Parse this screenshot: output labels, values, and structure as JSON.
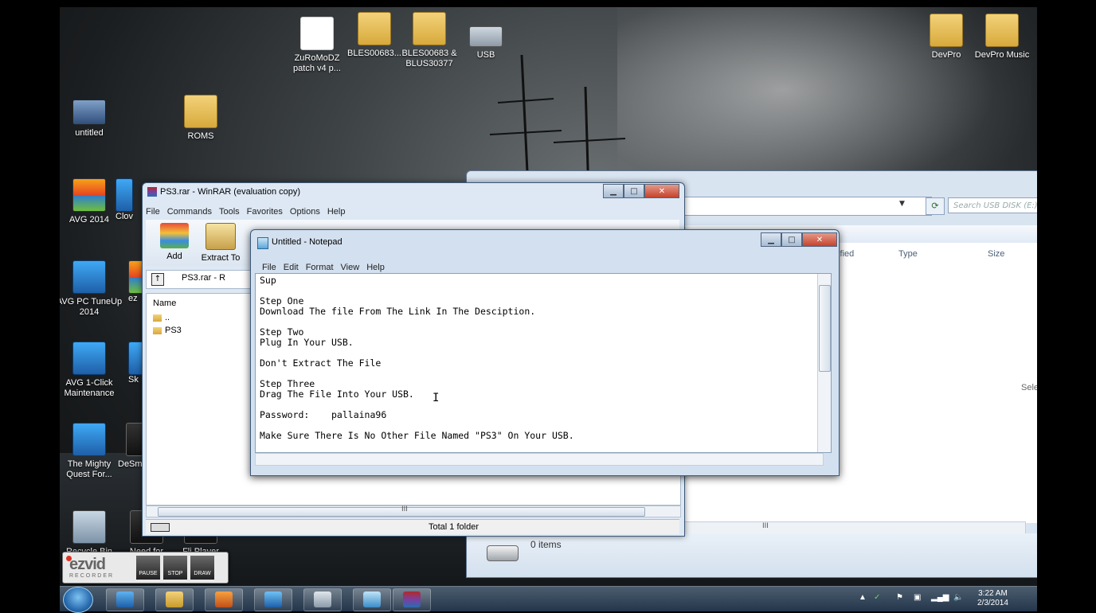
{
  "desktop": {
    "icons": [
      {
        "label": "ZuRoMoDZ patch v4 p...",
        "icon": "file-icon"
      },
      {
        "label": "BLES00683...",
        "icon": "folder-icon"
      },
      {
        "label": "BLES00683 & BLUS30377",
        "icon": "folder-icon"
      },
      {
        "label": "USB",
        "icon": "usb-drive-icon"
      },
      {
        "label": "DevPro",
        "icon": "folder-icon"
      },
      {
        "label": "DevPro Music",
        "icon": "folder-icon"
      },
      {
        "label": "untitled",
        "icon": "image-icon"
      },
      {
        "label": "ROMS",
        "icon": "folder-icon"
      },
      {
        "label": "AVG 2014",
        "icon": "avg-icon"
      },
      {
        "label": "Clov",
        "icon": "app-icon"
      },
      {
        "label": "AVG PC TuneUp 2014",
        "icon": "tuneup-icon"
      },
      {
        "label": "ez",
        "icon": "app-icon"
      },
      {
        "label": "AVG 1-Click Maintenance",
        "icon": "maintenance-icon"
      },
      {
        "label": "Sk",
        "icon": "app-icon"
      },
      {
        "label": "The Mighty Quest For...",
        "icon": "game-icon"
      },
      {
        "label": "DeSm",
        "icon": "app-icon"
      },
      {
        "label": "Recycle Bin",
        "icon": "recycle-bin-icon"
      },
      {
        "label": "Need for",
        "icon": "game-icon"
      },
      {
        "label": "Fli Player",
        "icon": "app-icon"
      }
    ]
  },
  "explorer": {
    "search_placeholder": "Search USB DISK (E:)",
    "columns": [
      "dified",
      "Type",
      "Size"
    ],
    "select_hint": "Sele",
    "scroll_grip": "III",
    "items_count": "0 items"
  },
  "winrar": {
    "title": "PS3.rar - WinRAR (evaluation copy)",
    "menu": [
      "File",
      "Commands",
      "Tools",
      "Favorites",
      "Options",
      "Help"
    ],
    "toolbar": {
      "add": "Add",
      "extract": "Extract To"
    },
    "path": "PS3.rar - R",
    "name_header": "Name",
    "rows": [
      "..",
      "PS3"
    ],
    "scroll_grip": "III",
    "status": "Total 1 folder"
  },
  "notepad": {
    "title": "Untitled - Notepad",
    "menu": [
      "File",
      "Edit",
      "Format",
      "View",
      "Help"
    ],
    "text": "Sup\n\nStep One\nDownload The file From The Link In The Desciption.\n\nStep Two\nPlug In Your USB.\n\nDon't Extract The File\n\nStep Three\nDrag The File Into Your USB.\n\nPassword:    pallaina96\n\nMake Sure There Is No Other File Named \"PS3\" On Your USB."
  },
  "ezvid": {
    "logo": "ezvid",
    "sub": "RECORDER",
    "buttons": [
      "PAUSE",
      "STOP",
      "DRAW"
    ]
  },
  "taskbar": {
    "clock_time": "3:22 AM",
    "clock_date": "2/3/2014",
    "apps": [
      "internet-explorer-icon",
      "file-explorer-icon",
      "media-player-icon",
      "tuneup-icon",
      "games-icon",
      "notepad-icon",
      "winrar-icon"
    ]
  },
  "colors": {
    "window_frame": "#d3e0ef",
    "close_button": "#c5432c",
    "taskbar": "#28405a"
  }
}
